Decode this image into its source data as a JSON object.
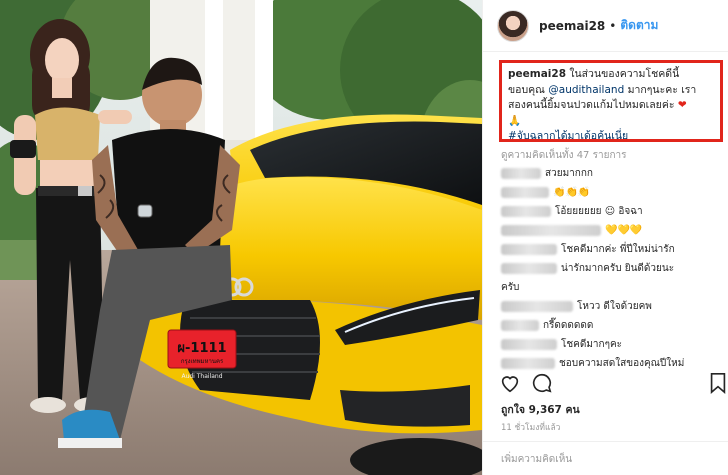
{
  "post": {
    "username": "peemai28",
    "separator": "•",
    "follow_label": "ติดตาม"
  },
  "caption": {
    "username": "peemai28",
    "text_part1": " ในส่วนของความโชคดีนี้ ขอบคุณ ",
    "mention": "@audithailand",
    "text_part2": " มากๆนะคะ เราสองคนนี้ยิ้มจนปวดแก้มไปหมดเลยค่ะ ",
    "heart": "❤",
    "pray": "🙏",
    "hashtag": "#จับฉลากได้มาเด้อค้นเนี่ย"
  },
  "view_all_comments": "ดูความคิดเห็นทั้ง 47 รายการ",
  "comments": [
    {
      "text": "สวยมากกก"
    },
    {
      "text": "👏👏👏"
    },
    {
      "text": "โอ้ยยยยยย ☺ อิจฉา"
    },
    {
      "text": "💛💛💛"
    },
    {
      "text": "โชคดีมากค่ะ พี่ปีใหม่น่ารัก"
    },
    {
      "text": "น่ารักมากครับ ยินดีด้วยนะ"
    },
    {
      "text": "ครับ"
    },
    {
      "text": "โหวว ดีใจด้วยคพ"
    },
    {
      "text": "กรี๊ดดดดดด"
    },
    {
      "text": "โชคดีมากๆคะ"
    },
    {
      "text": "ชอบความสดใสของคุณปีใหม่"
    }
  ],
  "icons": {
    "like": "heart-outline-icon",
    "comment": "speech-bubble-icon",
    "save": "bookmark-icon"
  },
  "likes_text": "ถูกใจ 9,367 คน",
  "time_ago": "11 ชั่วโมงที่แล้ว",
  "add_comment_placeholder": "เพิ่มความคิดเห็น",
  "photo": {
    "plate_number": "ผ-1111",
    "plate_province": "กรุงเทพมหานคร",
    "dealer_text": "Audi Thailand"
  }
}
